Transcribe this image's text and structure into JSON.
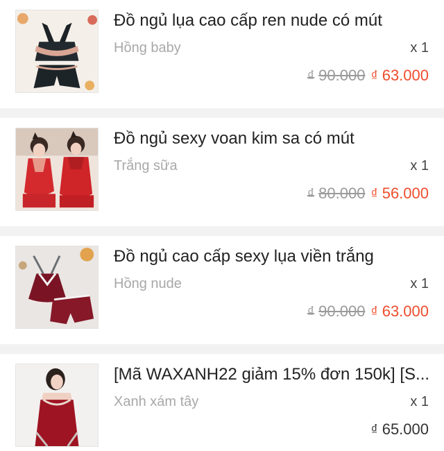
{
  "orders": [
    {
      "title": "Đồ ngủ lụa cao cấp ren nude có mút",
      "variant": "Hồng baby",
      "quantity": "x 1",
      "currency": "₫",
      "old_price": "90.000",
      "price": "63.000",
      "image": "product-photo-black-silk-lace-set"
    },
    {
      "title": "Đồ ngủ sexy voan kim sa có mút",
      "variant": "Trắng sữa",
      "quantity": "x 1",
      "currency": "₫",
      "old_price": "80.000",
      "price": "56.000",
      "image": "product-photo-red-chiffon-set"
    },
    {
      "title": "Đồ ngủ cao cấp sexy lụa viền trắng",
      "variant": "Hồng nude",
      "quantity": "x 1",
      "currency": "₫",
      "old_price": "90.000",
      "price": "63.000",
      "image": "product-photo-burgundy-velvet-set"
    },
    {
      "title": "[Mã WAXANH22 giảm 15% đơn 150k] [S...",
      "variant": "Xanh xám tây",
      "quantity": "x 1",
      "currency": "₫",
      "old_price": "",
      "price": "65.000",
      "image": "product-photo-red-satin-dress"
    }
  ],
  "colors": {
    "accent": "#ee4d2d",
    "muted": "#a8a8a8",
    "background": "#f2f2f2"
  }
}
